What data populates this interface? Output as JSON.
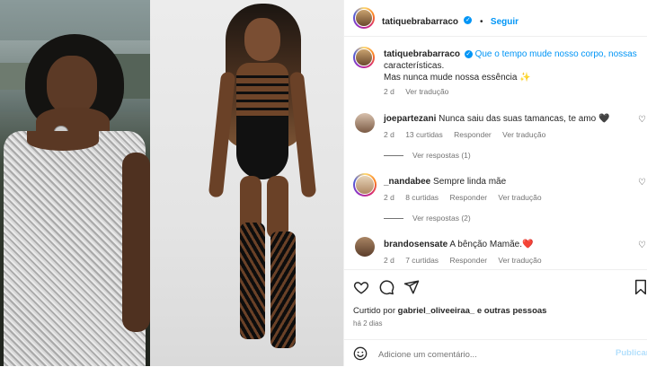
{
  "post": {
    "username": "tatiquebrabarraco",
    "follow_label": "Seguir",
    "caption_line1": "Que o tempo mude nosso corpo, nossas",
    "caption_line2": "características.",
    "caption_line3": "Mas nunca mude nossa essência ✨",
    "caption_age": "2 d",
    "see_translation": "Ver tradução"
  },
  "comments": [
    {
      "username": "joepartezani",
      "text": "Nunca saiu das suas tamancas, te amo 🖤",
      "age": "2 d",
      "likes": "13 curtidas",
      "reply": "Responder",
      "translate": "Ver tradução",
      "replies": "Ver respostas (1)"
    },
    {
      "username": "_nandabee",
      "text": "Sempre linda mãe",
      "age": "2 d",
      "likes": "8 curtidas",
      "reply": "Responder",
      "translate": "Ver tradução",
      "replies": "Ver respostas (2)"
    },
    {
      "username": "brandosensate",
      "text": "A bênção Mamãe.❤️",
      "age": "2 d",
      "likes": "7 curtidas",
      "reply": "Responder",
      "translate": "Ver tradução"
    }
  ],
  "likes_text": {
    "prefix": "Curtido por",
    "user": "gabriel_oliveeiraa_",
    "suffix": "e outras pessoas"
  },
  "post_age": "há 2 dias",
  "comment_input": {
    "placeholder": "Adicione um comentário...",
    "publish_label": "Publicar"
  },
  "icons": [
    "verified-icon",
    "heart-icon",
    "comment-icon",
    "share-icon",
    "bookmark-icon",
    "emoji-icon"
  ],
  "colors": {
    "accent": "#0095f6",
    "muted": "#737373",
    "text": "#262626"
  }
}
